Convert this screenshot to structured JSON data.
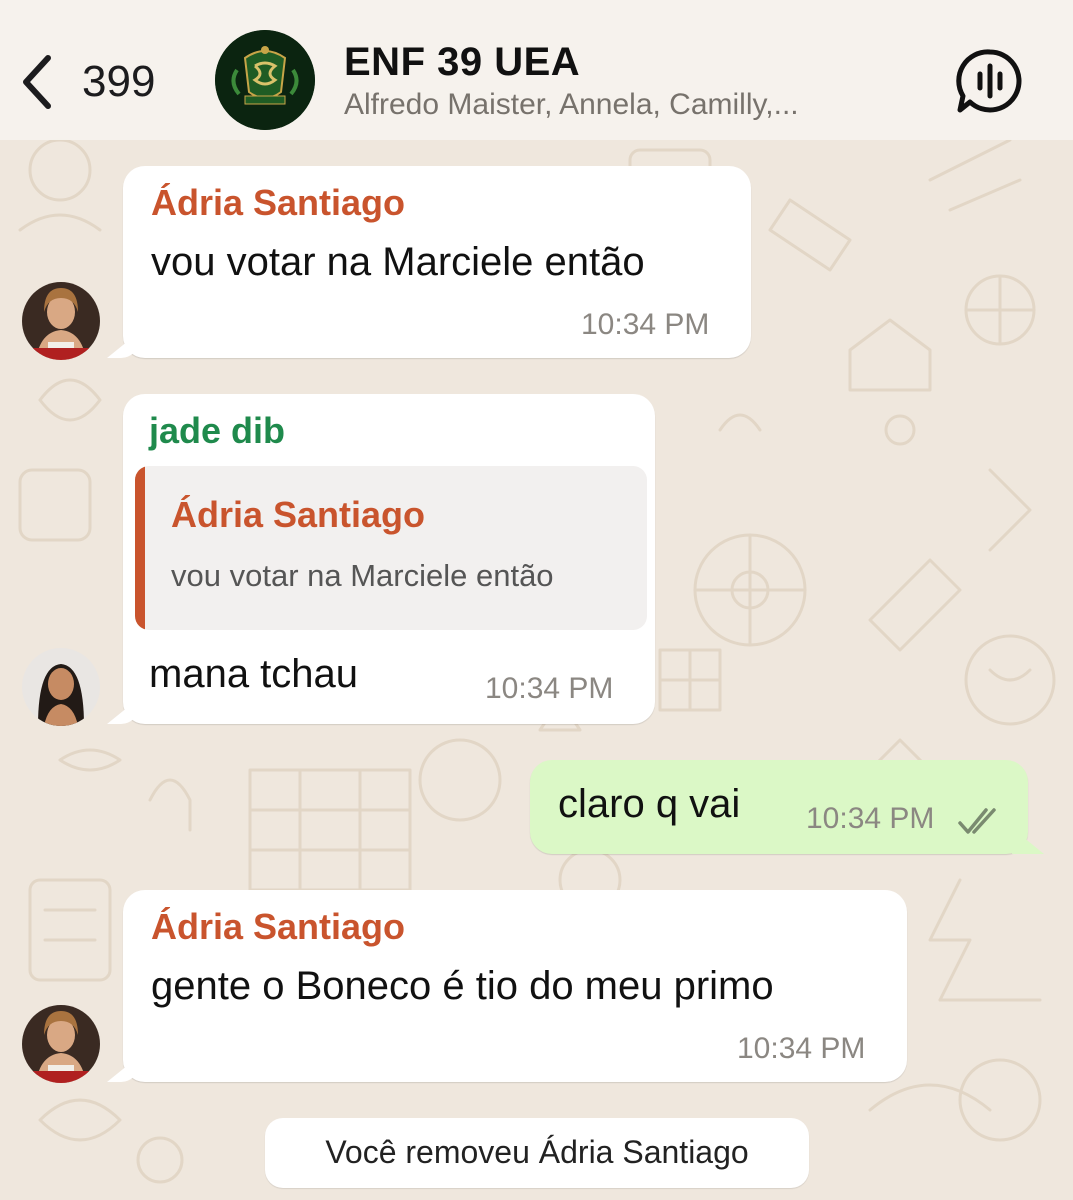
{
  "header": {
    "back_count": "399",
    "title": "ENF 39 UEA",
    "subtitle": "Alfredo Maister, Annela, Camilly,...",
    "avatar_icon": "group-crest-icon",
    "voice_icon": "voice-chat-icon"
  },
  "messages": [
    {
      "sender": "Ádria Santiago",
      "text": "vou votar na Marciele então",
      "time": "10:34 PM"
    },
    {
      "sender": "jade dib",
      "quote_sender": "Ádria Santiago",
      "quote_text": "vou votar na Marciele então",
      "text": "mana tchau",
      "time": "10:34 PM"
    },
    {
      "text": "claro q vai",
      "time": "10:34 PM",
      "status": "read"
    },
    {
      "sender": "Ádria Santiago",
      "text": "gente o Boneco é tio do meu primo",
      "time": "10:34 PM"
    }
  ],
  "system_message": "Você removeu Ádria Santiago",
  "colors": {
    "adria_name": "#c9542d",
    "jade_name": "#1f8a4c",
    "outgoing_bubble": "#dbf8c6",
    "incoming_bubble": "#ffffff",
    "background": "#efe7dd"
  }
}
